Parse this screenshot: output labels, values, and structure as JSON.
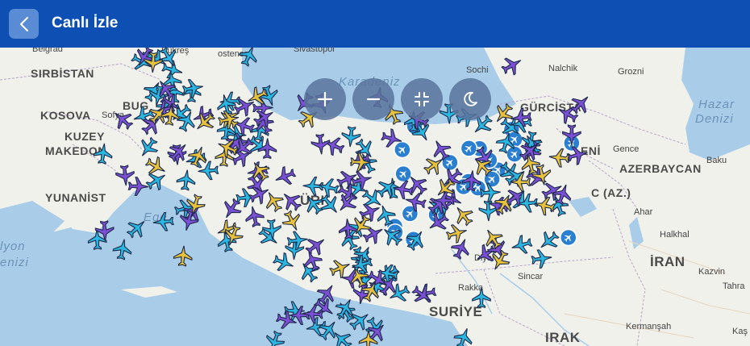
{
  "header": {
    "title": "Canlı İzle",
    "back_icon": "chevron-left-icon"
  },
  "colors": {
    "header": "#0d4fb3",
    "plane_cyan": "#29b6e0",
    "plane_purple": "#7b4fd6",
    "plane_yellow": "#e8c23a",
    "airport": "#2a7fd0"
  },
  "controls": [
    {
      "name": "zoom-in-button",
      "icon": "plus-icon",
      "glyph": "+"
    },
    {
      "name": "zoom-out-button",
      "icon": "minus-icon",
      "glyph": "−"
    },
    {
      "name": "fit-bounds-button",
      "icon": "compress-icon",
      "glyph": ""
    },
    {
      "name": "dark-mode-button",
      "icon": "moon-icon",
      "glyph": ""
    }
  ],
  "map": {
    "labels": {
      "sirbistan": "SIRBİSTAN",
      "kosova": "KOSOVA",
      "kuzey": "KUZEY",
      "makedon": "MAKEDON",
      "yunanistan": "YUNANİST",
      "bug": "BUG",
      "sofya": "Sofya",
      "bukres": "Bükreş",
      "beograd": "Belgrad",
      "costence": "ostence",
      "sivastopol": "Sivastopol",
      "karadeniz": "Karadeniz",
      "sochi": "Sochi",
      "nalchik": "Nalchik",
      "grozni": "Grozni",
      "iran_top": "IRAN",
      "gurcistan": "GÜRCİSTA",
      "hazar1": "Hazar",
      "hazar2": "Denizi",
      "baku": "Baku",
      "azerbaycan": "AZERBAYCAN",
      "gence": "Gence",
      "ermeni": "ENİ",
      "az": "C (AZ.)",
      "ahar": "Ahar",
      "halkhal": "Halkhal",
      "iran": "İRAN",
      "kazvin": "Kazvin",
      "tahran": "Tahra",
      "iyon1": "lyon",
      "iyon2": "enizi",
      "ege": "Ege",
      "tur": "ÜRK",
      "diyarb": "Diyar",
      "sincar": "Sincar",
      "rakka": "Rakka",
      "suriye": "SURİYE",
      "irak": "IRAK",
      "kermansah": "Kermanşah",
      "kas": "Kaş"
    },
    "plane_counts": {
      "cyan": 95,
      "purple": 85,
      "yellow": 40
    },
    "airport_count": 22
  }
}
